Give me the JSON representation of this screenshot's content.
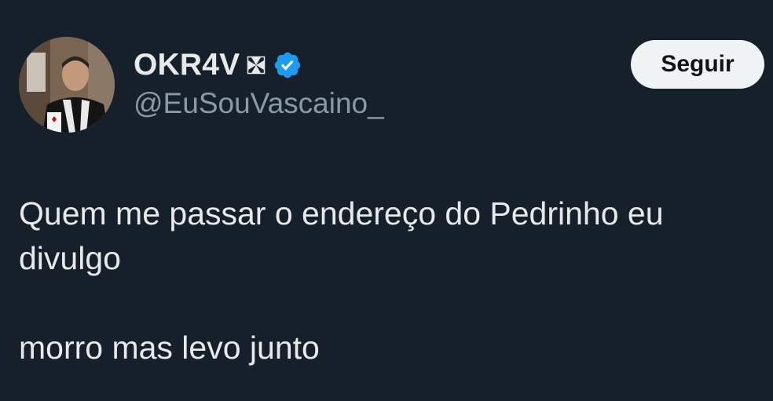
{
  "author": {
    "display_name": "OKR4V",
    "name_badge_icon": "maltese-cross-icon",
    "verified_icon": "verified-badge-icon",
    "handle": "@EuSouVascaino_",
    "avatar_icon": "profile-photo"
  },
  "follow_button": {
    "label": "Seguir"
  },
  "tweet": {
    "line1": "Quem me passar o endereço do Pedrinho eu",
    "line2": "divulgo",
    "line3": "morro mas levo junto"
  },
  "colors": {
    "background": "#15202b",
    "primary_text": "#e7e9ea",
    "secondary_text": "#8b98a5",
    "verified_blue": "#1d9bf0",
    "button_bg": "#eff3f4",
    "button_text": "#0f1419"
  }
}
